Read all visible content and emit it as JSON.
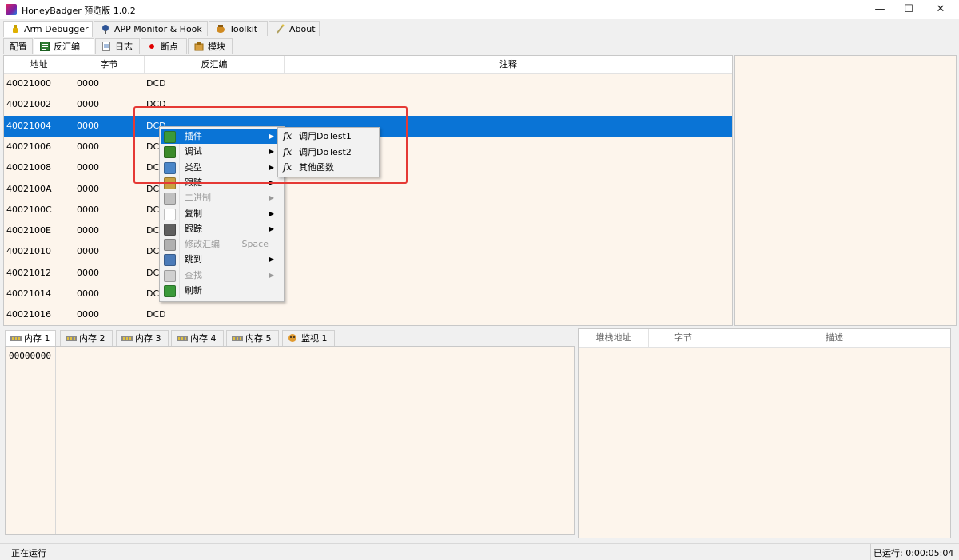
{
  "window": {
    "title": "HoneyBadger 预览版 1.0.2",
    "controls": {
      "minimize": "—",
      "maximize": "☐",
      "close": "✕"
    }
  },
  "main_tabs": [
    {
      "label": "Arm Debugger",
      "icon": "lamp-icon"
    },
    {
      "label": "APP Monitor & Hook",
      "icon": "mic-icon"
    },
    {
      "label": "Toolkit",
      "icon": "honeypot-icon"
    },
    {
      "label": "About",
      "icon": "wand-icon"
    }
  ],
  "sub_tabs": [
    {
      "label": "配置"
    },
    {
      "label": "反汇编",
      "icon": "disasm-icon"
    },
    {
      "label": "日志",
      "icon": "log-icon"
    },
    {
      "label": "断点",
      "icon": "breakpoint-icon"
    },
    {
      "label": "模块",
      "icon": "module-icon"
    }
  ],
  "disasm": {
    "headers": [
      "地址",
      "字节",
      "反汇编",
      "注释"
    ],
    "rows": [
      {
        "addr": "40021000",
        "bytes": "0000",
        "asm": "DCD"
      },
      {
        "addr": "40021002",
        "bytes": "0000",
        "asm": "DCD"
      },
      {
        "addr": "40021004",
        "bytes": "0000",
        "asm": "DCD"
      },
      {
        "addr": "40021006",
        "bytes": "0000",
        "asm": "DCD"
      },
      {
        "addr": "40021008",
        "bytes": "0000",
        "asm": "DCD"
      },
      {
        "addr": "4002100A",
        "bytes": "0000",
        "asm": "DCD"
      },
      {
        "addr": "4002100C",
        "bytes": "0000",
        "asm": "DCD"
      },
      {
        "addr": "4002100E",
        "bytes": "0000",
        "asm": "DCD"
      },
      {
        "addr": "40021010",
        "bytes": "0000",
        "asm": "DCD"
      },
      {
        "addr": "40021012",
        "bytes": "0000",
        "asm": "DCD"
      },
      {
        "addr": "40021014",
        "bytes": "0000",
        "asm": "DCD"
      },
      {
        "addr": "40021016",
        "bytes": "0000",
        "asm": "DCD"
      }
    ],
    "selected_index": 2
  },
  "context_menu": {
    "items": [
      {
        "label": "插件",
        "icon": "plugin-icon",
        "submenu": true
      },
      {
        "label": "调试",
        "icon": "bug-icon",
        "submenu": true
      },
      {
        "label": "类型",
        "icon": "type-icon",
        "submenu": true
      },
      {
        "label": "跟随",
        "icon": "follow-icon",
        "submenu": true
      },
      {
        "label": "二进制",
        "icon": "binary-icon",
        "submenu": true,
        "disabled": true
      },
      {
        "label": "复制",
        "icon": "copy-icon",
        "submenu": true
      },
      {
        "label": "跟踪",
        "icon": "trace-icon",
        "submenu": true
      },
      {
        "label": "修改汇编",
        "icon": "edit-asm-icon",
        "shortcut": "Space",
        "disabled": true
      },
      {
        "label": "跳到",
        "icon": "goto-icon",
        "submenu": true
      },
      {
        "label": "查找",
        "icon": "search-icon",
        "submenu": true,
        "disabled": true
      },
      {
        "label": "刷新",
        "icon": "refresh-icon"
      }
    ],
    "submenu_items": [
      {
        "label": "调用DoTest1",
        "icon": "fx"
      },
      {
        "label": "调用DoTest2",
        "icon": "fx"
      },
      {
        "label": "其他函数",
        "icon": "fx"
      }
    ]
  },
  "memory_tabs": [
    {
      "label": "内存 1",
      "icon": "memory-icon"
    },
    {
      "label": "内存 2",
      "icon": "memory-icon"
    },
    {
      "label": "内存 3",
      "icon": "memory-icon"
    },
    {
      "label": "内存 4",
      "icon": "memory-icon"
    },
    {
      "label": "内存 5",
      "icon": "memory-icon"
    },
    {
      "label": "监视 1",
      "icon": "watch-icon"
    }
  ],
  "memory": {
    "first_addr": "00000000"
  },
  "stack": {
    "headers": [
      "堆栈地址",
      "字节",
      "描述"
    ]
  },
  "status": {
    "left": "正在运行",
    "right": "已运行: 0:00:05:04"
  },
  "colors": {
    "selection": "#0a74d6",
    "panel_bg": "#fdf5ec",
    "annotation": "#e53935"
  }
}
